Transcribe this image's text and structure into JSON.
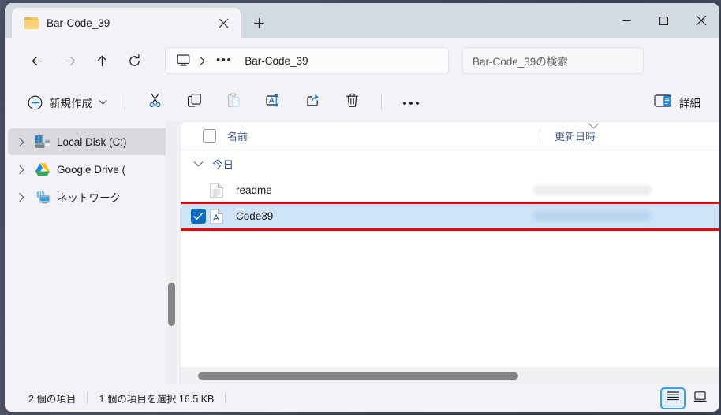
{
  "window": {
    "tab_title": "Bar-Code_39",
    "tab_folder_icon": "folder-icon",
    "tab_close_icon": "close-icon",
    "new_tab_icon": "plus-icon",
    "minimize_icon": "minimize-icon",
    "maximize_icon": "maximize-icon",
    "close_icon": "close-icon"
  },
  "nav": {
    "back_icon": "arrow-left-icon",
    "forward_icon": "arrow-right-icon",
    "up_icon": "arrow-up-icon",
    "refresh_icon": "refresh-icon",
    "breadcrumb_root_icon": "this-pc-monitor-icon",
    "breadcrumb_separator": "chevron-right-icon",
    "breadcrumb_overflow": "•••",
    "breadcrumb_current": "Bar-Code_39",
    "search_placeholder": "Bar-Code_39の検索",
    "search_visible_text": "Bar-Code_39の検"
  },
  "toolbar": {
    "new_label": "新規作成",
    "new_icon": "plus-circle-icon",
    "new_caret_icon": "chevron-down-icon",
    "cut_icon": "scissors-icon",
    "copy_icon": "copy-icon",
    "paste_icon": "paste-icon",
    "rename_icon": "rename-icon",
    "share_icon": "share-icon",
    "delete_icon": "trash-icon",
    "more_icon": "ellipsis-icon",
    "details_label": "詳細",
    "details_icon": "details-pane-icon"
  },
  "sidebar": {
    "items": [
      {
        "label": "Local Disk (C:)",
        "icon": "local-disk-icon",
        "chevron": "chevron-right-icon",
        "selected": true
      },
      {
        "label": "Google Drive (",
        "icon": "google-drive-icon",
        "chevron": "chevron-right-icon",
        "selected": false
      },
      {
        "label": "ネットワーク",
        "icon": "network-icon",
        "chevron": "chevron-right-icon",
        "selected": false
      }
    ]
  },
  "filelist": {
    "columns": {
      "name": "名前",
      "date_modified": "更新日時",
      "sort_icon": "chevron-down-icon",
      "select_all_checkbox": "checkbox-unchecked"
    },
    "group": {
      "label": "今日",
      "chevron": "chevron-down-icon"
    },
    "rows": [
      {
        "name": "readme",
        "icon": "text-file-icon",
        "selected": false,
        "checked": false,
        "annotated": false,
        "date_modified": ""
      },
      {
        "name": "Code39",
        "icon": "image-file-icon",
        "selected": true,
        "checked": true,
        "annotated": true,
        "date_modified": ""
      }
    ]
  },
  "statusbar": {
    "item_count": "2 個の項目",
    "selection": "1 個の項目を選択  16.5 KB",
    "view_details_icon": "details-view-icon",
    "view_icons_icon": "large-icons-view-icon",
    "active_view": "details"
  },
  "colors": {
    "accent": "#0f6cbd",
    "selection_row": "#cfe4f7",
    "annotation_border": "#ee0000",
    "group_label": "#2f4f9e",
    "window_bg": "#f3f3f7",
    "titlebar_bg": "#d4dae4",
    "desktop_bg": "#4a5465"
  }
}
